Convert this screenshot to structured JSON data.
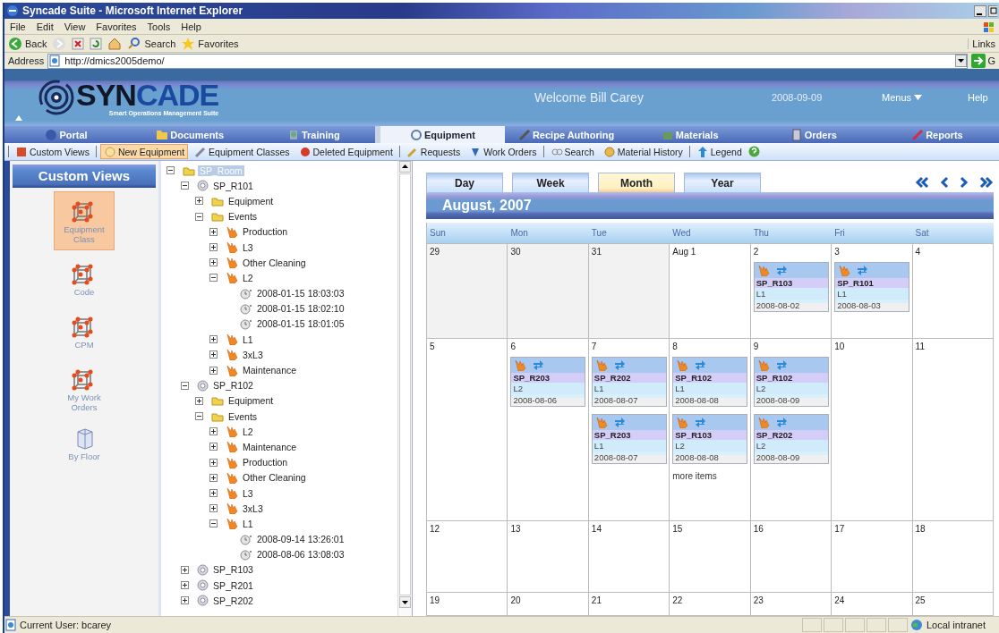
{
  "window": {
    "title": "Syncade Suite - Microsoft Internet Explorer"
  },
  "menu_bar": [
    "File",
    "Edit",
    "View",
    "Favorites",
    "Tools",
    "Help"
  ],
  "browser_toolbar": {
    "buttons": [
      "Back",
      "Search",
      "Favorites"
    ],
    "links": "Links"
  },
  "address_bar": {
    "label": "Address",
    "value": "http://dmics2005demo/",
    "go": "G"
  },
  "app_header": {
    "logo_main": "SYN",
    "logo_accent": "CADE",
    "tagline": "Smart Operations Management Suite",
    "welcome": "Welcome Bill Carey",
    "date": "2008-09-09",
    "menus": "Menus",
    "help": "Help"
  },
  "nav_tabs": [
    {
      "label": "Portal",
      "selected": false
    },
    {
      "label": "Documents",
      "selected": false
    },
    {
      "label": "Training",
      "selected": false
    },
    {
      "label": "Equipment",
      "selected": true
    },
    {
      "label": "Recipe Authoring",
      "selected": false
    },
    {
      "label": "Materials",
      "selected": false
    },
    {
      "label": "Orders",
      "selected": false
    },
    {
      "label": "Reports",
      "selected": false
    }
  ],
  "toolbar": {
    "groups": [
      [
        {
          "label": "Custom Views",
          "selected": false
        }
      ],
      [
        {
          "label": "New Equipment",
          "selected": true
        },
        {
          "label": "Equipment Classes",
          "selected": false
        },
        {
          "label": "Deleted Equipment",
          "selected": false
        }
      ],
      [
        {
          "label": "Requests",
          "selected": false
        },
        {
          "label": "Work Orders",
          "selected": false
        }
      ],
      [
        {
          "label": "Search",
          "selected": false
        },
        {
          "label": "Material History",
          "selected": false
        }
      ],
      [
        {
          "label": "Legend",
          "selected": false
        }
      ]
    ]
  },
  "custom_views": {
    "title": "Custom Views",
    "items": [
      {
        "label": "Equipment Class",
        "kind": "cube",
        "selected": true
      },
      {
        "label": "Code",
        "kind": "cube",
        "selected": false
      },
      {
        "label": "CPM",
        "kind": "cube",
        "selected": false
      },
      {
        "label": "My Work Orders",
        "kind": "cube",
        "selected": false
      },
      {
        "label": "By Floor",
        "kind": "floor",
        "selected": false
      }
    ]
  },
  "tree": [
    {
      "label": "SP_Room",
      "kind": "folder",
      "expanded": true,
      "selected": true,
      "children": [
        {
          "label": "SP_R101",
          "kind": "gear",
          "expanded": true,
          "selected": false,
          "children": [
            {
              "label": "Equipment",
              "kind": "folder",
              "expanded": false,
              "selected": false
            },
            {
              "label": "Events",
              "kind": "folder",
              "expanded": true,
              "selected": false,
              "children": [
                {
                  "label": "Production",
                  "kind": "flame",
                  "expanded": false,
                  "selected": false
                },
                {
                  "label": "L3",
                  "kind": "flame",
                  "expanded": false,
                  "selected": false
                },
                {
                  "label": "Other Cleaning",
                  "kind": "flame",
                  "expanded": false,
                  "selected": false
                },
                {
                  "label": "L2",
                  "kind": "flame",
                  "expanded": true,
                  "selected": false,
                  "children": [
                    {
                      "label": "2008-01-15 18:03:03",
                      "kind": "record",
                      "selected": false
                    },
                    {
                      "label": "2008-01-15 18:02:10",
                      "kind": "record",
                      "selected": false
                    },
                    {
                      "label": "2008-01-15 18:01:05",
                      "kind": "record",
                      "selected": false
                    }
                  ]
                },
                {
                  "label": "L1",
                  "kind": "flame",
                  "expanded": false,
                  "selected": false
                },
                {
                  "label": "3xL3",
                  "kind": "flame",
                  "expanded": false,
                  "selected": false
                },
                {
                  "label": "Maintenance",
                  "kind": "flame",
                  "expanded": false,
                  "selected": false
                }
              ]
            }
          ]
        },
        {
          "label": "SP_R102",
          "kind": "gear",
          "expanded": true,
          "selected": false,
          "children": [
            {
              "label": "Equipment",
              "kind": "folder",
              "expanded": false,
              "selected": false
            },
            {
              "label": "Events",
              "kind": "folder",
              "expanded": true,
              "selected": false,
              "children": [
                {
                  "label": "L2",
                  "kind": "flame",
                  "expanded": false,
                  "selected": false
                },
                {
                  "label": "Maintenance",
                  "kind": "flame",
                  "expanded": false,
                  "selected": false
                },
                {
                  "label": "Production",
                  "kind": "flame",
                  "expanded": false,
                  "selected": false
                },
                {
                  "label": "Other Cleaning",
                  "kind": "flame",
                  "expanded": false,
                  "selected": false
                },
                {
                  "label": "L3",
                  "kind": "flame",
                  "expanded": false,
                  "selected": false
                },
                {
                  "label": "3xL3",
                  "kind": "flame",
                  "expanded": false,
                  "selected": false
                },
                {
                  "label": "L1",
                  "kind": "flame",
                  "expanded": true,
                  "selected": false,
                  "children": [
                    {
                      "label": "2008-09-14 13:26:01",
                      "kind": "record",
                      "selected": false
                    },
                    {
                      "label": "2008-08-06 13:08:03",
                      "kind": "record",
                      "selected": false
                    }
                  ]
                }
              ]
            }
          ]
        },
        {
          "label": "SP_R103",
          "kind": "gear",
          "expanded": false,
          "selected": false
        },
        {
          "label": "SP_R201",
          "kind": "gear",
          "expanded": false,
          "selected": false
        },
        {
          "label": "SP_R202",
          "kind": "gear",
          "expanded": false,
          "selected": false
        }
      ]
    }
  ],
  "calendar": {
    "views": [
      {
        "label": "Day",
        "selected": false
      },
      {
        "label": "Week",
        "selected": false
      },
      {
        "label": "Month",
        "selected": true
      },
      {
        "label": "Year",
        "selected": false
      }
    ],
    "title": "August, 2007",
    "weekdays": [
      "Sun",
      "Mon",
      "Tue",
      "Wed",
      "Thu",
      "Fri",
      "Sat"
    ],
    "weeks": [
      {
        "days": [
          {
            "day": "29",
            "in_month": false
          },
          {
            "day": "30",
            "in_month": false
          },
          {
            "day": "31",
            "in_month": false
          },
          {
            "day": "Aug 1",
            "in_month": true
          },
          {
            "day": "2",
            "in_month": true,
            "events": [
              {
                "room": "SP_R103",
                "line": "L1",
                "date": "2008-08-02"
              }
            ]
          },
          {
            "day": "3",
            "in_month": true,
            "events": [
              {
                "room": "SP_R101",
                "line": "L1",
                "date": "2008-08-03"
              }
            ]
          },
          {
            "day": "4",
            "in_month": true
          }
        ]
      },
      {
        "days": [
          {
            "day": "5",
            "in_month": true
          },
          {
            "day": "6",
            "in_month": true,
            "events": [
              {
                "room": "SP_R203",
                "line": "L2",
                "date": "2008-08-06"
              }
            ]
          },
          {
            "day": "7",
            "in_month": true,
            "events": [
              {
                "room": "SP_R202",
                "line": "L1",
                "date": "2008-08-07"
              },
              {
                "room": "SP_R203",
                "line": "L1",
                "date": "2008-08-07"
              }
            ]
          },
          {
            "day": "8",
            "in_month": true,
            "events": [
              {
                "room": "SP_R102",
                "line": "L1",
                "date": "2008-08-08"
              },
              {
                "room": "SP_R103",
                "line": "L2",
                "date": "2008-08-08"
              }
            ],
            "more": "more items"
          },
          {
            "day": "9",
            "in_month": true,
            "events": [
              {
                "room": "SP_R102",
                "line": "L2",
                "date": "2008-08-09"
              },
              {
                "room": "SP_R202",
                "line": "L2",
                "date": "2008-08-09"
              }
            ]
          },
          {
            "day": "10",
            "in_month": true
          },
          {
            "day": "11",
            "in_month": true
          }
        ]
      },
      {
        "days": [
          {
            "day": "12",
            "in_month": true
          },
          {
            "day": "13",
            "in_month": true
          },
          {
            "day": "14",
            "in_month": true
          },
          {
            "day": "15",
            "in_month": true
          },
          {
            "day": "16",
            "in_month": true
          },
          {
            "day": "17",
            "in_month": true
          },
          {
            "day": "18",
            "in_month": true
          }
        ]
      },
      {
        "days": [
          {
            "day": "19",
            "in_month": true
          },
          {
            "day": "20",
            "in_month": true
          },
          {
            "day": "21",
            "in_month": true
          },
          {
            "day": "22",
            "in_month": true
          },
          {
            "day": "23",
            "in_month": true
          },
          {
            "day": "24",
            "in_month": true
          },
          {
            "day": "25",
            "in_month": true
          }
        ]
      }
    ]
  },
  "status_bar": {
    "user": "Current User: bcarey",
    "zone": "Local intranet"
  }
}
